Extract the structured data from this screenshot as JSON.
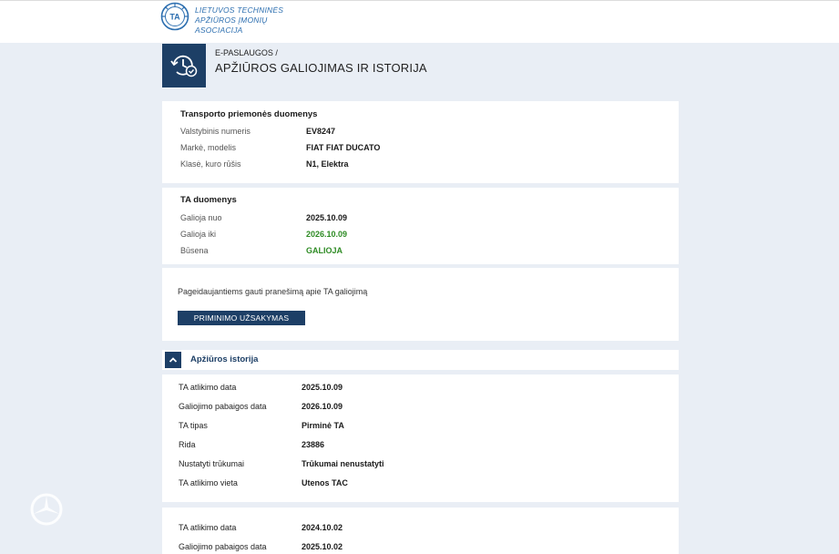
{
  "header": {
    "logo_mark": "TA",
    "logo_line1": "LIETUVOS TECHNINĖS",
    "logo_line2": "APŽIŪROS ĮMONIŲ ASOCIACIJA"
  },
  "page": {
    "breadcrumb": "E-PASLAUGOS /",
    "title": "APŽIŪROS GALIOJIMAS IR ISTORIJA"
  },
  "vehicle": {
    "title": "Transporto priemonės duomenys",
    "rows": [
      {
        "label": "Valstybinis numeris",
        "value": "EV8247"
      },
      {
        "label": "Markė, modelis",
        "value": "FIAT FIAT DUCATO"
      },
      {
        "label": "Klasė, kuro rūšis",
        "value": "N1, Elektra"
      }
    ]
  },
  "ta": {
    "title": "TA duomenys",
    "rows": [
      {
        "label": "Galioja nuo",
        "value": "2025.10.09"
      },
      {
        "label": "Galioja iki",
        "value": "2026.10.09"
      },
      {
        "label": "Būsena",
        "value": "GALIOJA"
      }
    ]
  },
  "reminder": {
    "text": "Pageidaujantiems gauti pranešimą apie TA galiojimą",
    "button": "PRIMINIMO UŽSAKYMAS"
  },
  "history": {
    "title": "Apžiūros istorija",
    "entries": [
      {
        "rows": [
          {
            "label": "TA atlikimo data",
            "value": "2025.10.09"
          },
          {
            "label": "Galiojimo pabaigos data",
            "value": "2026.10.09"
          },
          {
            "label": "TA tipas",
            "value": "Pirminė TA"
          },
          {
            "label": "Rida",
            "value": "23886"
          },
          {
            "label": "Nustatyti trūkumai",
            "value": "Trūkumai nenustatyti"
          },
          {
            "label": "TA atlikimo vieta",
            "value": "Utenos TAC"
          }
        ]
      },
      {
        "rows": [
          {
            "label": "TA atlikimo data",
            "value": "2024.10.02"
          },
          {
            "label": "Galiojimo pabaigos data",
            "value": "2025.10.02"
          }
        ]
      }
    ]
  },
  "colors": {
    "navy": "#1d3f66",
    "valid_green": "#2e8b24",
    "page_bg": "#e9eef5",
    "logo_blue": "#2d6fb0"
  }
}
